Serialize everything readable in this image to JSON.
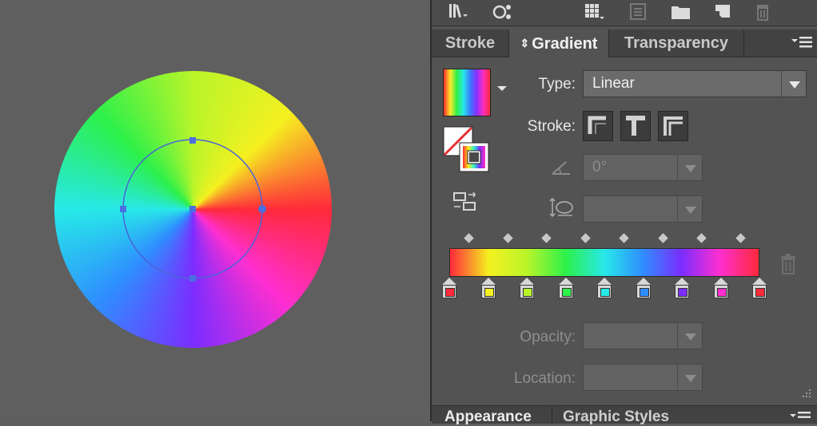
{
  "toolbar": {
    "icons": [
      "library-icon",
      "artboard-link-icon",
      "grid-swatch-icon",
      "list-view-icon",
      "folder-icon",
      "new-item-icon",
      "delete-icon"
    ]
  },
  "tabs": {
    "stroke": "Stroke",
    "gradient": "Gradient",
    "transparency": "Transparency"
  },
  "gradient": {
    "type_label": "Type:",
    "type_value": "Linear",
    "stroke_label": "Stroke:",
    "angle_value": "0°",
    "aspect_value": "",
    "opacity_label": "Opacity:",
    "opacity_value": "",
    "location_label": "Location:",
    "location_value": "",
    "stops": [
      {
        "color": "#ff2a3a"
      },
      {
        "color": "#f5f020"
      },
      {
        "color": "#b9f52a"
      },
      {
        "color": "#2df04a"
      },
      {
        "color": "#27e8e8"
      },
      {
        "color": "#2f8dff"
      },
      {
        "color": "#7b2dff"
      },
      {
        "color": "#ff2fd0"
      },
      {
        "color": "#ff2a3a"
      }
    ]
  },
  "bottom_tabs": {
    "appearance": "Appearance",
    "graphic_styles": "Graphic Styles"
  }
}
